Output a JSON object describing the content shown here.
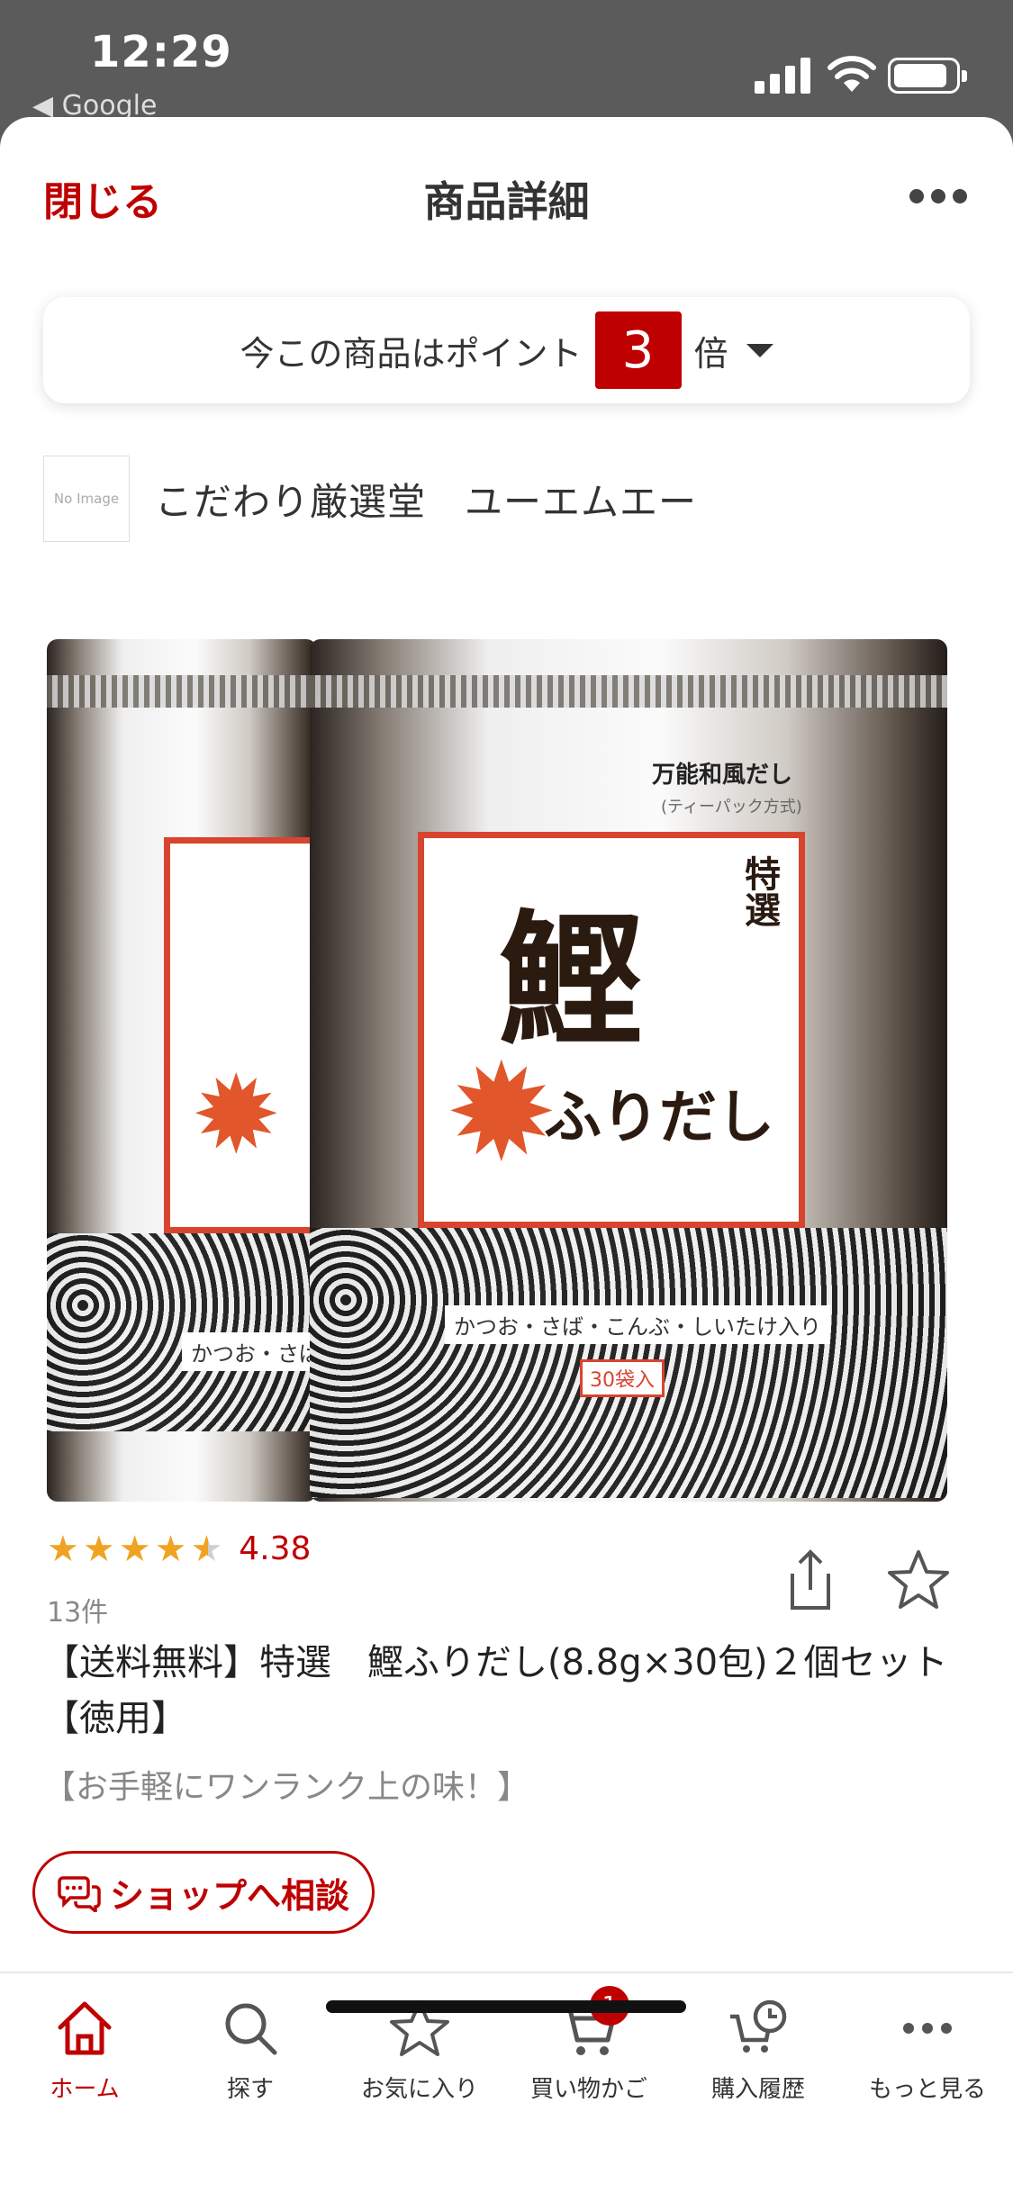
{
  "status_bar": {
    "time": "12:29",
    "back_app": "◀ Google"
  },
  "nav": {
    "close_label": "閉じる",
    "title": "商品詳細"
  },
  "points": {
    "prefix": "今この商品はポイント",
    "multiplier": "3",
    "suffix": "倍"
  },
  "shop": {
    "logo_placeholder": "No Image",
    "name": "こだわり厳選堂　ユーエムエー"
  },
  "product_image": {
    "package_top_text": "万能和風だし",
    "package_sub_text": "(ティーパック方式)",
    "package_tokusen": "特選",
    "package_kanji": "鰹",
    "package_script": "ふりだし",
    "package_ingredients": "かつお・さば・こんぶ・しいたけ入り",
    "package_ingredients_partial": "かつお・さば",
    "package_count": "30袋入"
  },
  "rating": {
    "value": "4.38",
    "stars": 4.38,
    "review_count": "13件"
  },
  "product": {
    "title": "【送料無料】特選　鰹ふりだし(8.8g×30包)２個セット【徳用】",
    "catch_copy": "【お手軽にワンランク上の味！】"
  },
  "consult": {
    "label": "ショップへ相談"
  },
  "tabs": [
    {
      "label": "ホーム",
      "icon": "home-icon",
      "active": true
    },
    {
      "label": "探す",
      "icon": "search-icon",
      "active": false
    },
    {
      "label": "お気に入り",
      "icon": "star-icon",
      "active": false
    },
    {
      "label": "買い物かご",
      "icon": "cart-icon",
      "active": false,
      "badge": "1"
    },
    {
      "label": "購入履歴",
      "icon": "history-icon",
      "active": false
    },
    {
      "label": "もっと見る",
      "icon": "more-icon",
      "active": false
    }
  ],
  "colors": {
    "accent": "#bf0000",
    "star": "#f0a322"
  }
}
